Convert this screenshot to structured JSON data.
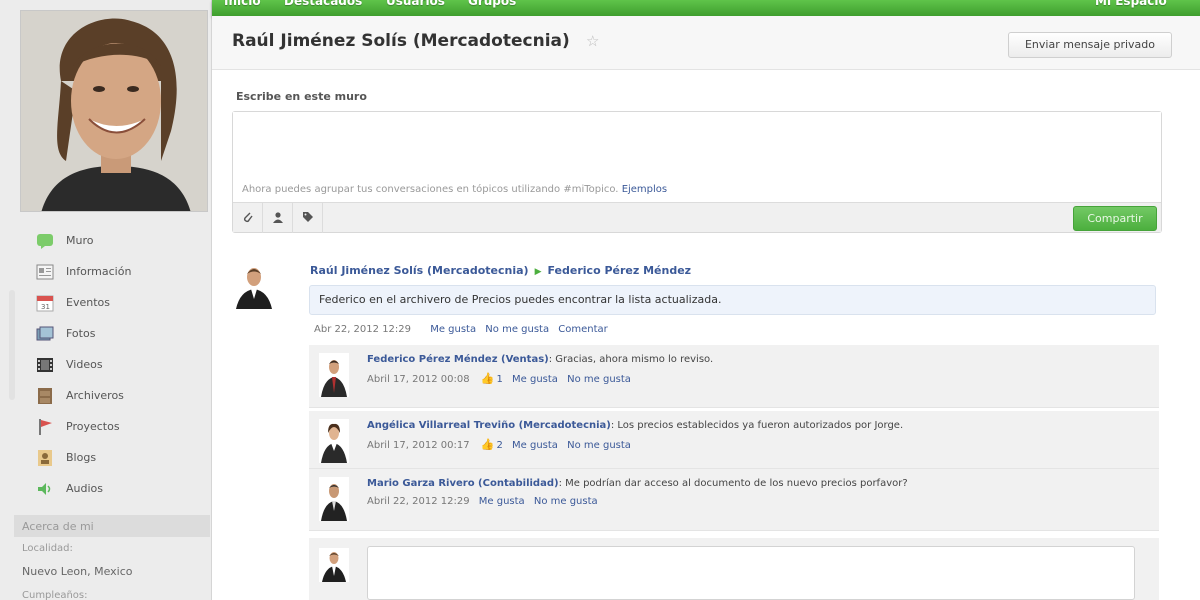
{
  "topnav": {
    "items": [
      "Inicio",
      "Destacados",
      "Usuarios",
      "Grupos"
    ],
    "right": "Mi Espacio"
  },
  "sidebar": {
    "items": [
      {
        "label": "Muro",
        "icon": "wall-icon"
      },
      {
        "label": "Información",
        "icon": "info-icon"
      },
      {
        "label": "Eventos",
        "icon": "calendar-icon"
      },
      {
        "label": "Fotos",
        "icon": "photos-icon"
      },
      {
        "label": "Videos",
        "icon": "video-icon"
      },
      {
        "label": "Archiveros",
        "icon": "archive-icon"
      },
      {
        "label": "Proyectos",
        "icon": "flag-icon"
      },
      {
        "label": "Blogs",
        "icon": "blog-icon"
      },
      {
        "label": "Audios",
        "icon": "audio-icon"
      }
    ],
    "about_title": "Acerca de mi",
    "location_label": "Localidad:",
    "location_value": "Nuevo Leon, Mexico",
    "birthday_label": "Cumpleaños:"
  },
  "profile": {
    "name": "Raúl Jiménez Solís (Mercadotecnia)",
    "message_button": "Enviar mensaje privado"
  },
  "wall": {
    "title": "Escribe en este muro",
    "hint": "Ahora puedes agrupar tus conversaciones en tópicos utilizando #miTopico.",
    "hint_link": "Ejemplos",
    "share_button": "Compartir"
  },
  "post": {
    "author": "Raúl Jiménez Solís (Mercadotecnia)",
    "recipient": "Federico Pérez Méndez",
    "text": "Federico en el archivero de Precios puedes encontrar la lista actualizada.",
    "date": "Abr 22, 2012 12:29",
    "like": "Me gusta",
    "dislike": "No me gusta",
    "comment": "Comentar"
  },
  "comments": [
    {
      "author": "Federico Pérez Méndez (Ventas)",
      "text": ": Gracias, ahora mismo lo reviso.",
      "date": "Abril 17, 2012 00:08",
      "likes": "1",
      "like": "Me gusta",
      "dislike": "No me gusta"
    },
    {
      "author": "Angélica Villarreal Treviño (Mercadotecnia)",
      "text": ": Los precios establecidos ya fueron autorizados por Jorge.",
      "date": "Abril 17, 2012 00:17",
      "likes": "2",
      "like": "Me gusta",
      "dislike": "No me gusta"
    },
    {
      "author": "Mario Garza Rivero (Contabilidad)",
      "text": ": Me podrían dar acceso al documento de los nuevo precios porfavor?",
      "date": "Abril 22, 2012 12:29",
      "like": "Me gusta",
      "dislike": "No me gusta"
    }
  ],
  "colors": {
    "brand_green": "#4caf3e",
    "link_blue": "#3b5998"
  }
}
